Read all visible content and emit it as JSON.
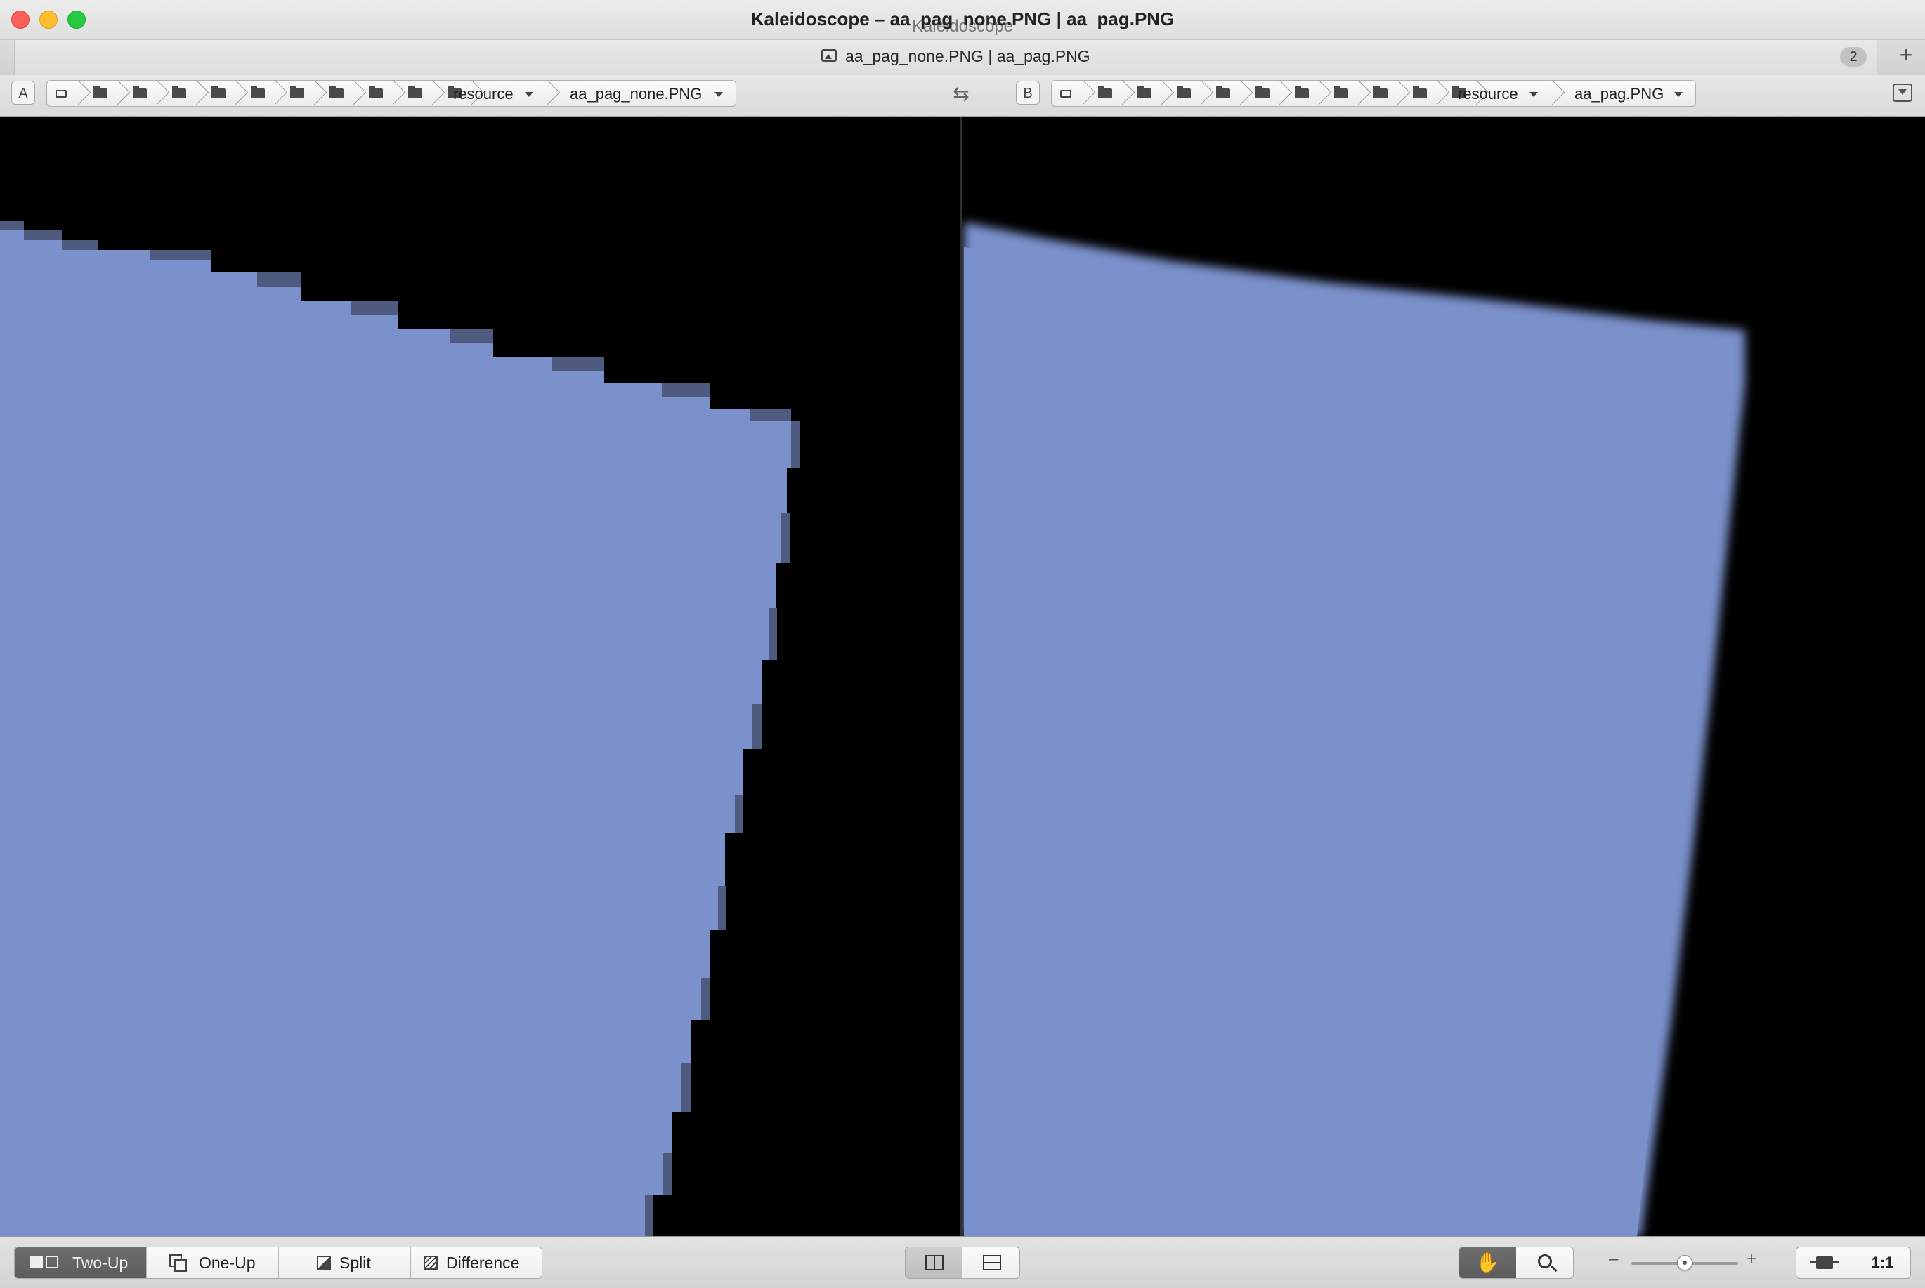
{
  "window": {
    "title": "Kaleidoscope – aa_pag_none.PNG | aa_pag.PNG",
    "app_name": "Kaleidoscope"
  },
  "tab": {
    "label": "aa_pag_none.PNG | aa_pag.PNG",
    "count": "2",
    "icon": "image-icon",
    "add_icon": "+"
  },
  "left_path": {
    "badge": "A",
    "folder": "resource",
    "file": "aa_pag_none.PNG"
  },
  "right_path": {
    "badge": "B",
    "folder": "resource",
    "file": "aa_pag.PNG"
  },
  "swap_icon": "⇆",
  "modes": [
    {
      "label": "Two-Up",
      "selected": true
    },
    {
      "label": "One-Up",
      "selected": false
    },
    {
      "label": "Split",
      "selected": false
    },
    {
      "label": "Difference",
      "selected": false
    }
  ],
  "layout": {
    "selected": "side-by-side"
  },
  "tools": {
    "selected": "hand",
    "hand_icon": "✋"
  },
  "zoom": {
    "minus": "–",
    "plus": "+",
    "level": 0.5,
    "one_to_one": "1:1"
  },
  "colors": {
    "shape": "#7a91cb",
    "background": "#000000",
    "selected_button": "#646464"
  }
}
